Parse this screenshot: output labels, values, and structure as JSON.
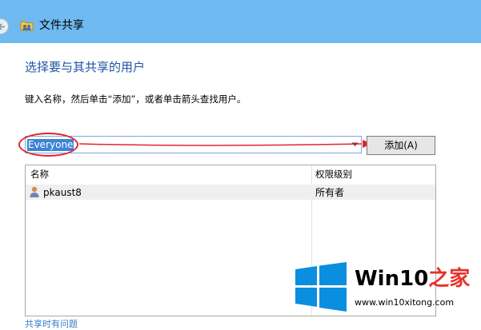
{
  "window": {
    "title": "文件共享"
  },
  "page": {
    "heading": "选择要与其共享的用户",
    "instruction": "键入名称，然后单击“添加”，或者单击箭头查找用户。"
  },
  "name_input": {
    "value": "Everyone"
  },
  "add_button": {
    "label": "添加(A)"
  },
  "table": {
    "columns": [
      "名称",
      "权限级别"
    ],
    "rows": [
      {
        "name": "pkaust8",
        "permission": "所有者"
      }
    ]
  },
  "bottom_link": "共享时有问题",
  "watermark": {
    "title_part1": "Win10",
    "title_part2": "之家",
    "url": "www.win10xitong.com",
    "accent_color": "#e8312b",
    "logo_color": "#0a8ee0"
  },
  "colors": {
    "titlebar": "#6fbaf0",
    "heading": "#1d53a5",
    "selection": "#3b84d6",
    "annotation": "#e2262c"
  }
}
